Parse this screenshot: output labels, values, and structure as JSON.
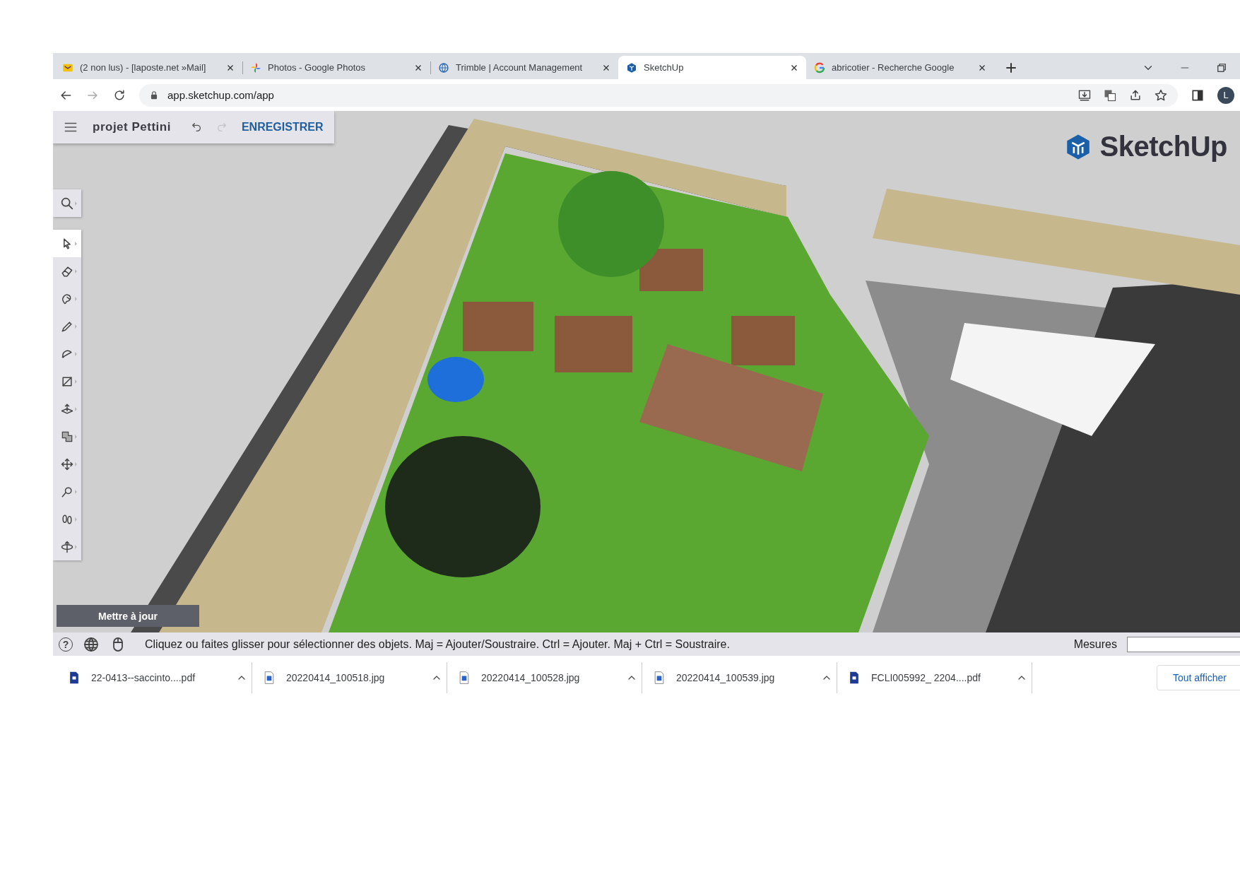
{
  "browser": {
    "tabs": [
      {
        "kind": "mail",
        "title": "(2 non lus) - [laposte.net »Mail]",
        "selected": false
      },
      {
        "kind": "photos",
        "title": "Photos - Google Photos",
        "selected": false
      },
      {
        "kind": "trimble",
        "title": "Trimble | Account Management",
        "selected": false
      },
      {
        "kind": "sketchup",
        "title": "SketchUp",
        "selected": true
      },
      {
        "kind": "google",
        "title": "abricotier - Recherche Google",
        "selected": false
      }
    ],
    "address": "app.sketchup.com/app",
    "profile_initial": "L"
  },
  "app": {
    "project_name": "projet Pettini",
    "undo": {
      "disabled": false
    },
    "redo": {
      "disabled": true
    },
    "save_label": "ENREGISTRER",
    "tools": [
      {
        "kind": "select",
        "selected": true
      },
      {
        "kind": "eraser",
        "selected": false
      },
      {
        "kind": "paint",
        "selected": false
      },
      {
        "kind": "line",
        "selected": false
      },
      {
        "kind": "arc",
        "selected": false
      },
      {
        "kind": "rectangle",
        "selected": false
      },
      {
        "kind": "pushpull",
        "selected": false
      },
      {
        "kind": "offset",
        "selected": false
      },
      {
        "kind": "move",
        "selected": false
      },
      {
        "kind": "tape",
        "selected": false
      },
      {
        "kind": "walk",
        "selected": false
      },
      {
        "kind": "orbit",
        "selected": false
      }
    ],
    "update_button": "Mettre à jour",
    "logo_text": "SketchUp"
  },
  "status_bar": {
    "help_glyph": "?",
    "hint": "Cliquez ou faites glisser pour sélectionner des objets. Maj = Ajouter/Soustraire. Ctrl = Ajouter. Maj + Ctrl = Soustraire.",
    "measurements_label": "Mesures"
  },
  "downloads": {
    "items": [
      {
        "kind": "pdf",
        "name": "22-0413--saccinto....pdf"
      },
      {
        "kind": "jpg",
        "name": "20220414_100518.jpg"
      },
      {
        "kind": "jpg",
        "name": "20220414_100528.jpg"
      },
      {
        "kind": "jpg",
        "name": "20220414_100539.jpg"
      },
      {
        "kind": "pdf",
        "name": "FCLI005992_  2204....pdf"
      }
    ],
    "show_all": "Tout afficher"
  }
}
